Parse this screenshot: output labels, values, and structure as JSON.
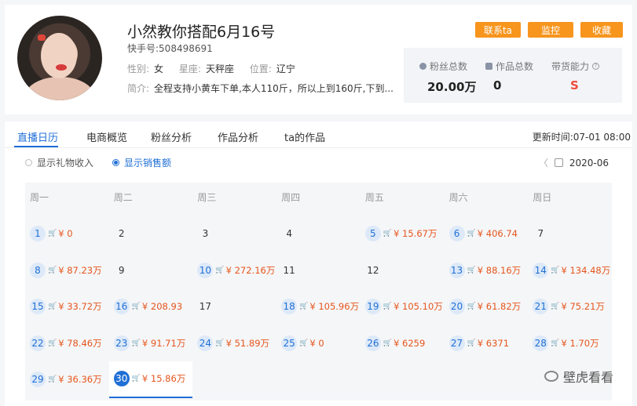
{
  "profile": {
    "name": "小然教你搭配6月16号",
    "uid": "快手号:508498691",
    "gender_label": "性别:",
    "gender": "女",
    "zodiac_label": "星座:",
    "zodiac": "天秤座",
    "location_label": "位置:",
    "location": "辽宁",
    "intro_label": "简介:",
    "intro": "全程支持小黄车下单,本人110斤，所以上到160斤,下到..."
  },
  "actions": {
    "contact": "联系ta",
    "monitor": "监控",
    "favorite": "收藏"
  },
  "stats": [
    {
      "label": "粉丝总数",
      "value": "20.00万"
    },
    {
      "label": "作品总数",
      "value": "0"
    },
    {
      "label": "带货能力",
      "value": "S"
    }
  ],
  "tabs": [
    "直播日历",
    "电商概览",
    "粉丝分析",
    "作品分析",
    "ta的作品"
  ],
  "update_time": "更新时间:07-01 08:00",
  "toggles": {
    "gift": "显示礼物收入",
    "sales": "显示销售额"
  },
  "month": "2020-06",
  "weekdays": [
    "周一",
    "周二",
    "周三",
    "周四",
    "周五",
    "周六",
    "周日"
  ],
  "days": [
    {
      "d": "1",
      "amount": "¥ 0"
    },
    {
      "d": "2",
      "amount": ""
    },
    {
      "d": "3",
      "amount": ""
    },
    {
      "d": "4",
      "amount": ""
    },
    {
      "d": "5",
      "amount": "¥ 15.67万"
    },
    {
      "d": "6",
      "amount": "¥ 406.74"
    },
    {
      "d": "7",
      "amount": ""
    },
    {
      "d": "8",
      "amount": "¥ 87.23万"
    },
    {
      "d": "9",
      "amount": ""
    },
    {
      "d": "10",
      "amount": "¥ 272.16万"
    },
    {
      "d": "11",
      "amount": ""
    },
    {
      "d": "12",
      "amount": ""
    },
    {
      "d": "13",
      "amount": "¥ 88.16万"
    },
    {
      "d": "14",
      "amount": "¥ 134.48万"
    },
    {
      "d": "15",
      "amount": "¥ 33.72万"
    },
    {
      "d": "16",
      "amount": "¥ 208.93"
    },
    {
      "d": "17",
      "amount": ""
    },
    {
      "d": "18",
      "amount": "¥ 105.96万"
    },
    {
      "d": "19",
      "amount": "¥ 105.10万"
    },
    {
      "d": "20",
      "amount": "¥ 61.82万"
    },
    {
      "d": "21",
      "amount": "¥ 75.21万"
    },
    {
      "d": "22",
      "amount": "¥ 78.46万"
    },
    {
      "d": "23",
      "amount": "¥ 91.71万"
    },
    {
      "d": "24",
      "amount": "¥ 51.89万"
    },
    {
      "d": "25",
      "amount": "¥ 0"
    },
    {
      "d": "26",
      "amount": "¥ 6259"
    },
    {
      "d": "27",
      "amount": "¥ 6371"
    },
    {
      "d": "28",
      "amount": "¥ 1.70万"
    },
    {
      "d": "29",
      "amount": "¥ 36.36万"
    },
    {
      "d": "30",
      "amount": "¥ 15.86万",
      "selected": true
    }
  ],
  "watermark": "壁虎看看",
  "colors": {
    "accent": "#1f6fd6",
    "button": "#f7951d",
    "amount": "#e6551c"
  }
}
